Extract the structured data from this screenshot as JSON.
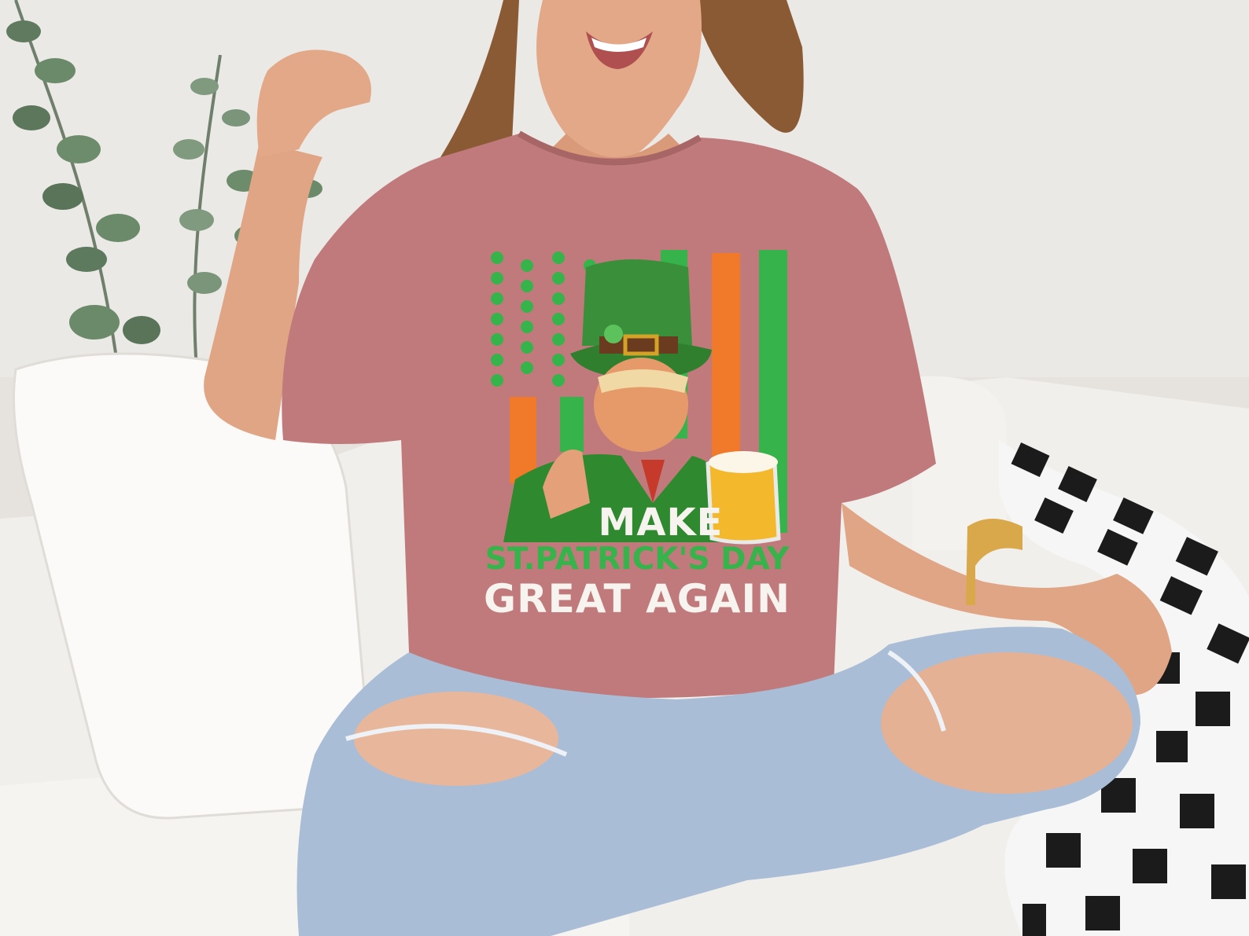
{
  "image": {
    "scene": "woman in pink t-shirt and ripped jeans sitting on white sofa",
    "colors": {
      "wall": "#ebe9e5",
      "shirt": "#c07a7b",
      "jeans": "#a9bdd6",
      "sofa": "#f4f2ee",
      "shamrock_green": "#36b34a",
      "flag_orange": "#f07a2a"
    }
  },
  "shirt_print": {
    "line1": "MAKE",
    "line2": "ST.PATRICK'S DAY",
    "line3": "GREAT AGAIN"
  }
}
